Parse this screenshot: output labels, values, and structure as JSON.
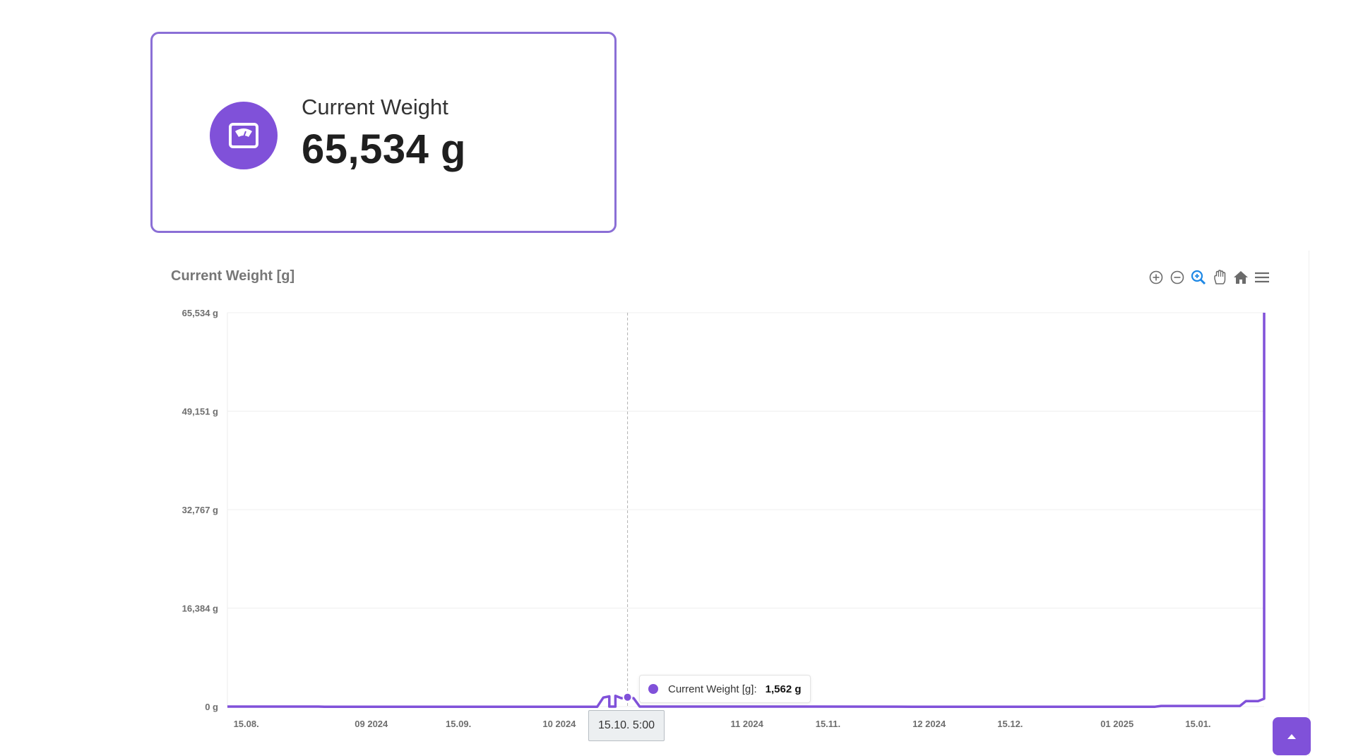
{
  "stat_card": {
    "label": "Current Weight",
    "value": "65,534 g",
    "icon": "scale-icon",
    "accent": "#8051d9"
  },
  "toolbar": {
    "icons": [
      "zoom-in-icon",
      "zoom-out-icon",
      "selection-zoom-icon",
      "pan-icon",
      "reset-home-icon",
      "menu-icon"
    ]
  },
  "tooltip": {
    "series_label": "Current Weight [g]:",
    "value": "1,562 g",
    "x_label": "15.10. 5:00"
  },
  "chart_data": {
    "type": "line",
    "title": "Current Weight [g]",
    "xlabel": "",
    "ylabel": "",
    "color": "#8051d9",
    "y_ticks": [
      "65,534 g",
      "49,151 g",
      "32,767 g",
      "16,384 g",
      "0 g"
    ],
    "y_tick_values": [
      65534,
      49151,
      32767,
      16384,
      0
    ],
    "ylim": [
      0,
      65534
    ],
    "x_range": [
      "2024-08-10",
      "2025-01-28"
    ],
    "x_ticks": [
      {
        "label": "15.08.",
        "date": "2024-08-11"
      },
      {
        "label": "09 2024",
        "date": "2024-08-31"
      },
      {
        "label": "15.09.",
        "date": "2024-09-15"
      },
      {
        "label": "10 2024",
        "date": "2024-10-01"
      },
      {
        "label": "11 2024",
        "date": "2024-11-01"
      },
      {
        "label": "15.11.",
        "date": "2024-11-15"
      },
      {
        "label": "12 2024",
        "date": "2024-12-01"
      },
      {
        "label": "15.12.",
        "date": "2024-12-15"
      },
      {
        "label": "01 2025",
        "date": "2025-01-01"
      },
      {
        "label": "15.01.",
        "date": "2025-01-15"
      }
    ],
    "grid": true,
    "crosshair_date": "2024-10-15",
    "series": [
      {
        "name": "Current Weight [g]",
        "points": [
          [
            "2024-08-10",
            0
          ],
          [
            "2024-08-25",
            0
          ],
          [
            "2024-08-26",
            -30
          ],
          [
            "2024-10-10",
            -20
          ],
          [
            "2024-10-11",
            1500
          ],
          [
            "2024-10-12",
            1700
          ],
          [
            "2024-10-12",
            0
          ],
          [
            "2024-10-13",
            0
          ],
          [
            "2024-10-13",
            1800
          ],
          [
            "2024-10-14",
            1400
          ],
          [
            "2024-10-15",
            1562
          ],
          [
            "2024-10-16",
            1400
          ],
          [
            "2024-10-17",
            0
          ],
          [
            "2024-10-20",
            0
          ],
          [
            "2024-11-15",
            0
          ],
          [
            "2024-12-01",
            -20
          ],
          [
            "2025-01-10",
            -20
          ],
          [
            "2025-01-11",
            100
          ],
          [
            "2025-01-24",
            100
          ],
          [
            "2025-01-25",
            900
          ],
          [
            "2025-01-27",
            900
          ],
          [
            "2025-01-28",
            1300
          ],
          [
            "2025-01-28",
            65534
          ]
        ]
      }
    ]
  }
}
